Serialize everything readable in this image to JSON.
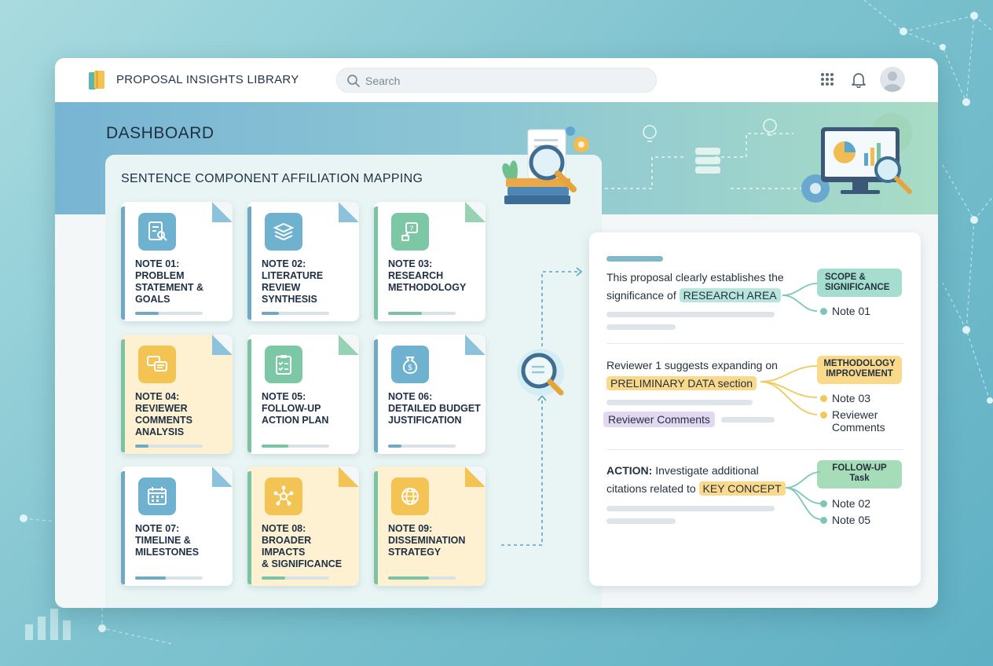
{
  "app": {
    "title": "PROPOSAL INSIGHTS LIBRARY"
  },
  "search": {
    "placeholder": "Search"
  },
  "icons": {
    "apps": "grid-icon",
    "notifications": "bell-icon",
    "profile": "avatar-icon"
  },
  "dashboard": {
    "title": "DASHBOARD"
  },
  "mapping": {
    "title": "SENTENCE COMPONENT AFFILIATION MAPPING",
    "notes": [
      {
        "label": "NOTE 01:\nPROBLEM\nSTATEMENT &\nGOALS",
        "icon": "document-search-icon",
        "progress": 0.35
      },
      {
        "label": "NOTE 02:\nLITERATURE\nREVIEW\nSYNTHESIS",
        "icon": "stack-icon",
        "progress": 0.25
      },
      {
        "label": "NOTE 03:\nRESEARCH\nMETHODOLOGY",
        "icon": "flowchart-icon",
        "progress": 0.5
      },
      {
        "label": "NOTE 04:\nREVIEWER\nCOMMENTS\nANALYSIS",
        "icon": "chat-bubbles-icon",
        "progress": 0.2
      },
      {
        "label": "NOTE 05:\nFOLLOW-UP\nACTION PLAN",
        "icon": "clipboard-icon",
        "progress": 0.4
      },
      {
        "label": "NOTE 06:\nDETAILED BUDGET\nJUSTIFICATION",
        "icon": "money-bag-icon",
        "progress": 0.2
      },
      {
        "label": "NOTE 07:\nTIMELINE &\nMILESTONES",
        "icon": "calendar-icon",
        "progress": 0.45
      },
      {
        "label": "NOTE 08:\nBROADER IMPACTS\n& SIGNIFICANCE",
        "icon": "network-icon",
        "progress": 0.35
      },
      {
        "label": "NOTE 09:\nDISSEMINATION\nSTRATEGY",
        "icon": "globe-icon",
        "progress": 0.6
      }
    ]
  },
  "details": {
    "item1": {
      "text_a": "This proposal clearly establishes the",
      "text_b": "significance of",
      "highlight": "RESEARCH AREA",
      "tag": "SCOPE &\nSIGNIFICANCE",
      "refs": [
        "Note 01"
      ]
    },
    "item2": {
      "text_a": "Reviewer 1 suggests expanding on",
      "highlight": "PRELIMINARY DATA section",
      "chip": "Reviewer Comments",
      "tag": "METHODOLOGY\nIMPROVEMENT",
      "refs": [
        "Note 03",
        "Reviewer\nComments"
      ]
    },
    "item3": {
      "action_label": "ACTION:",
      "text_a": "Investigate additional",
      "text_b": "citations related to",
      "highlight": "KEY CONCEPT",
      "tag": "FOLLOW-UP\nTask",
      "refs": [
        "Note 02",
        "Note 05"
      ]
    }
  },
  "colors": {
    "teal": "#8fd3c6",
    "yellow": "#f6cf73",
    "lavender": "#ddd0ef",
    "green": "#a7dcc0"
  }
}
